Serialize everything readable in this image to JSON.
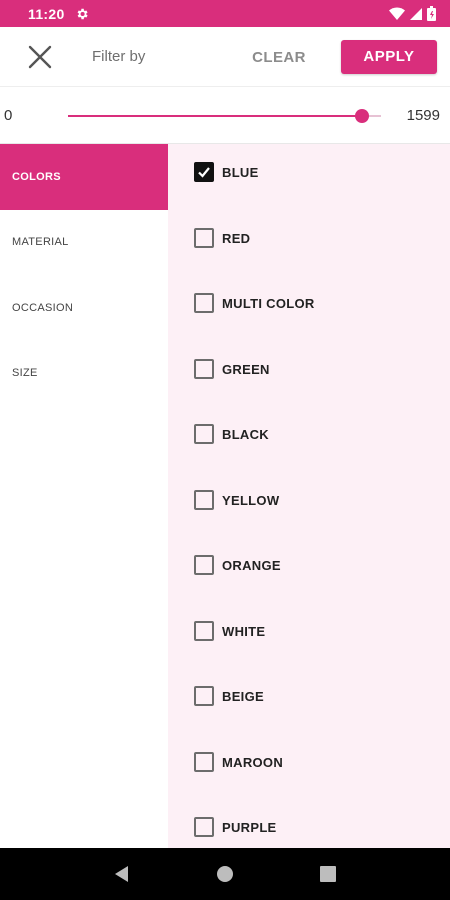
{
  "status": {
    "time": "11:20"
  },
  "header": {
    "title": "Filter by",
    "clear_label": "CLEAR",
    "apply_label": "APPLY"
  },
  "price": {
    "min_label": "0",
    "max_label": "1599",
    "slider_fraction": 0.94
  },
  "categories": [
    {
      "label": "COLORS",
      "active": true
    },
    {
      "label": "MATERIAL",
      "active": false
    },
    {
      "label": "OCCASION",
      "active": false
    },
    {
      "label": "SIZE",
      "active": false
    }
  ],
  "options": [
    {
      "label": "BLUE",
      "checked": true
    },
    {
      "label": "RED",
      "checked": false
    },
    {
      "label": "MULTI COLOR",
      "checked": false
    },
    {
      "label": "GREEN",
      "checked": false
    },
    {
      "label": "BLACK",
      "checked": false
    },
    {
      "label": "YELLOW",
      "checked": false
    },
    {
      "label": "ORANGE",
      "checked": false
    },
    {
      "label": "WHITE",
      "checked": false
    },
    {
      "label": "BEIGE",
      "checked": false
    },
    {
      "label": "MAROON",
      "checked": false
    },
    {
      "label": "PURPLE",
      "checked": false
    }
  ],
  "colors": {
    "accent": "#d92e7c",
    "panel": "#fdf0f6"
  }
}
